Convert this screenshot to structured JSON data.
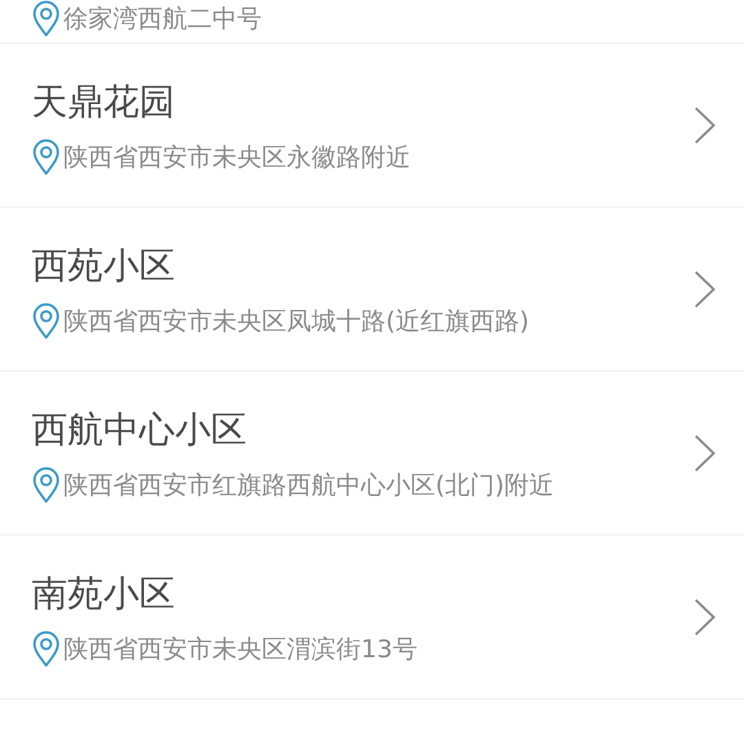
{
  "places": [
    {
      "address": "徐家湾西航二中号",
      "cut": true
    },
    {
      "name": "天鼎花园",
      "address": "陕西省西安市未央区永徽路附近",
      "cut": false
    },
    {
      "name": "西苑小区",
      "address": "陕西省西安市未央区凤城十路(近红旗西路)",
      "cut": false
    },
    {
      "name": "西航中心小区",
      "address": "陕西省西安市红旗路西航中心小区(北门)附近",
      "cut": false
    },
    {
      "name": "南苑小区",
      "address": "陕西省西安市未央区渭滨街13号",
      "cut": false
    }
  ]
}
